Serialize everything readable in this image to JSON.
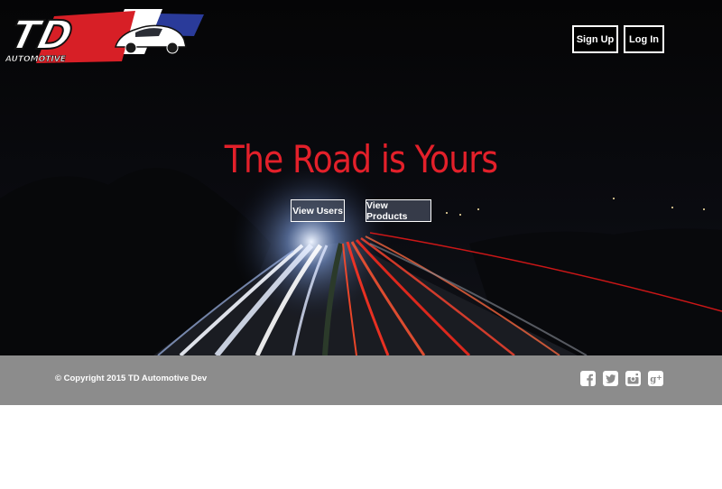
{
  "brand": {
    "logo_text": "TD",
    "logo_subtext": "AUTOMOTIVE",
    "colors": {
      "red": "#d71f26",
      "blue": "#2a3b9a",
      "white": "#ffffff"
    }
  },
  "nav": {
    "signup_label": "Sign Up",
    "login_label": "Log In"
  },
  "hero": {
    "headline": "The Road is Yours",
    "headline_color": "#e3202a",
    "buttons": {
      "view_users": "View Users",
      "view_products": "View Products"
    }
  },
  "footer": {
    "copyright": "© Copyright 2015 TD Automotive Dev",
    "background": "#8c8c8c",
    "social_icons": [
      "facebook-icon",
      "twitter-icon",
      "instagram-icon",
      "google-plus-icon"
    ]
  }
}
